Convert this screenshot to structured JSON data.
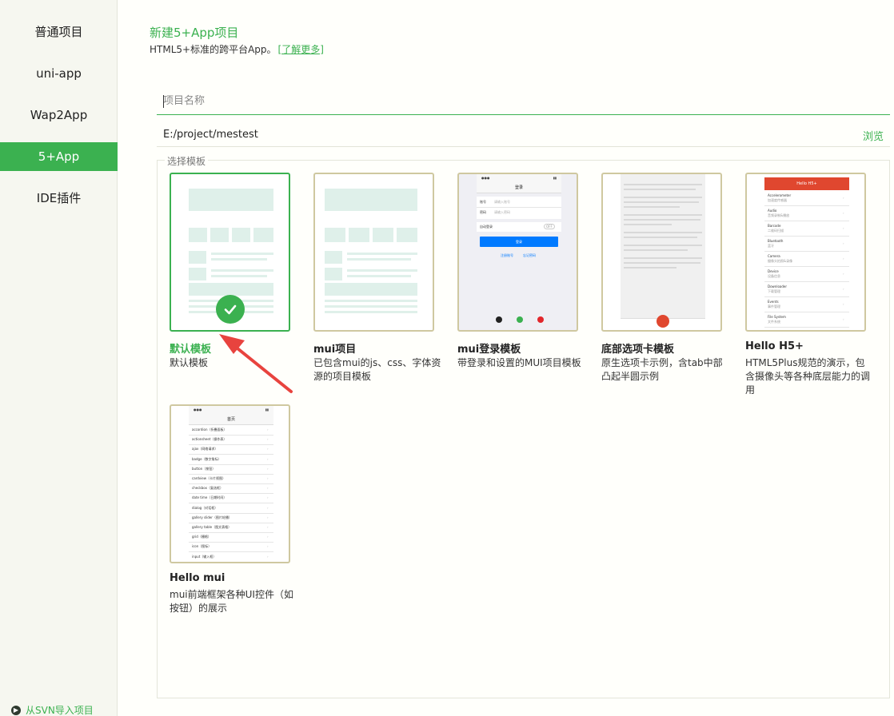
{
  "sidebar": {
    "items": [
      {
        "label": "普通项目"
      },
      {
        "label": "uni-app"
      },
      {
        "label": "Wap2App"
      },
      {
        "label": "5+App"
      },
      {
        "label": "IDE插件"
      }
    ],
    "active_index": 3,
    "svn_label": "从SVN导入项目"
  },
  "header": {
    "title": "新建5+App项目",
    "subtitle": "HTML5+标准的跨平台App。",
    "learn_more": "[了解更多]"
  },
  "form": {
    "name_placeholder": "项目名称",
    "path_value": "E:/project/mestest",
    "browse_label": "浏览"
  },
  "templates": {
    "legend": "选择模板",
    "selected_index": 0,
    "items": [
      {
        "title": "默认模板",
        "desc": "默认模板"
      },
      {
        "title": "mui项目",
        "desc": "已包含mui的js、css、字体资源的项目模板"
      },
      {
        "title": "mui登录模板",
        "desc": "带登录和设置的MUI项目模板"
      },
      {
        "title": "底部选项卡模板",
        "desc": "原生选项卡示例，含tab中部凸起半圆示例"
      },
      {
        "title": "Hello H5+",
        "desc": "HTML5Plus规范的演示，包含摄像头等各种底层能力的调用"
      },
      {
        "title": "Hello mui",
        "desc": "mui前端框架各种UI控件（如按钮）的展示"
      }
    ]
  },
  "previews": {
    "login": {
      "nav_title": "登录",
      "account": "账号",
      "account_ph": "请输入账号",
      "password": "密码",
      "password_ph": "请输入密码",
      "auto_login": "自动登录",
      "toggle": "OFF",
      "login_btn": "登录",
      "register": "注册账号",
      "forgot": "忘记密码"
    },
    "h5plus": {
      "nav_title": "Hello H5+",
      "rows": [
        {
          "name": "Accelerometer",
          "sub": "加速度传感器"
        },
        {
          "name": "Audio",
          "sub": "音频录制&播放"
        },
        {
          "name": "Barcode",
          "sub": "二维码扫描"
        },
        {
          "name": "Bluetooth",
          "sub": "蓝牙"
        },
        {
          "name": "Camera",
          "sub": "摄像头拍照&录像"
        },
        {
          "name": "Device",
          "sub": "设备信息"
        },
        {
          "name": "Downloader",
          "sub": "下载管理"
        },
        {
          "name": "Events",
          "sub": "事件管理"
        },
        {
          "name": "File System",
          "sub": "文件系统"
        }
      ]
    },
    "hellomui": {
      "nav_title": "首页",
      "rows": [
        "accordion（折叠面板）",
        "actionsheet（操作表）",
        "ajax（网络请求）",
        "badge（数字角标）",
        "button（按钮）",
        "cardview（卡片视图）",
        "checkbox（复选框）",
        "date time（日期时间）",
        "dialog（对话框）",
        "gallery slider（图片轮播）",
        "gallery table（图文表格）",
        "grid（栅格）",
        "icon（图标）",
        "input（输入框）"
      ]
    }
  },
  "colors": {
    "accent": "#3bb150",
    "card_border": "#cfc8a0",
    "h5_nav": "#e0472f",
    "login_btn": "#007aff"
  }
}
